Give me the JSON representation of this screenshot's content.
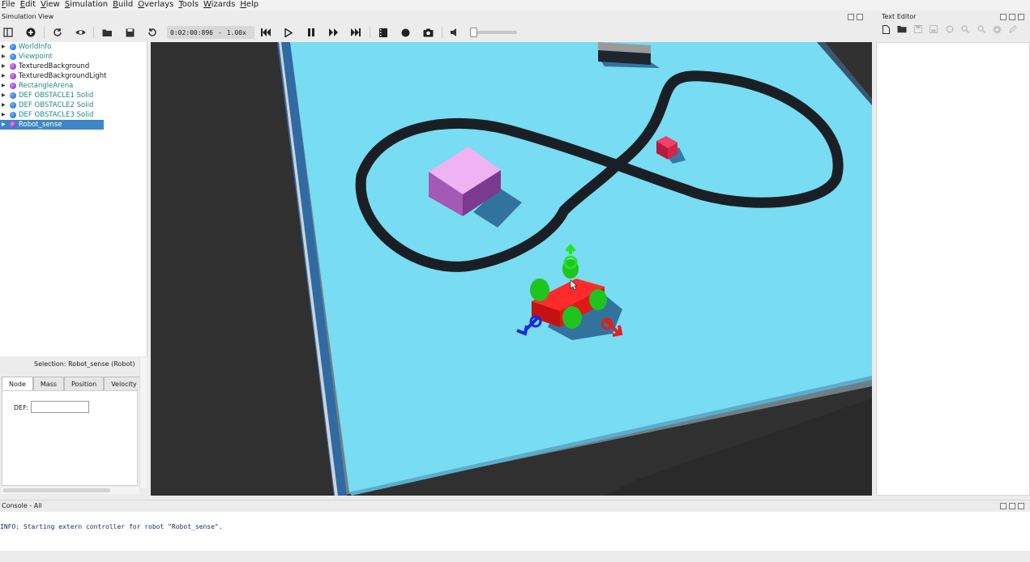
{
  "menu": [
    "File",
    "Edit",
    "View",
    "Simulation",
    "Build",
    "Overlays",
    "Tools",
    "Wizards",
    "Help"
  ],
  "simulation_view": {
    "title": "Simulation View"
  },
  "toolbar": {
    "icons": [
      "toggle-scene-tree-icon",
      "add-node-icon",
      "reload-icon",
      "eye-icon",
      "open-world-icon",
      "save-world-icon",
      "revert-icon",
      "step-back-icon",
      "play-icon",
      "pause-icon",
      "fast-forward-icon",
      "fastest-icon",
      "record-movie-icon",
      "record-icon",
      "screenshot-icon",
      "mute-icon"
    ],
    "time": "0:02:00:896",
    "time_separator": "-",
    "speed": "1.00x"
  },
  "scene_tree": {
    "items": [
      {
        "label": "WorldInfo",
        "icon": "blue",
        "teal": true
      },
      {
        "label": "Viewpoint",
        "icon": "blue",
        "teal": true
      },
      {
        "label": "TexturedBackground",
        "icon": "purple",
        "teal": false
      },
      {
        "label": "TexturedBackgroundLight",
        "icon": "purple",
        "teal": false
      },
      {
        "label": "RectangleArena",
        "icon": "purple",
        "teal": true
      },
      {
        "label": "DEF OBSTACLE1 Solid",
        "icon": "blue",
        "teal": true
      },
      {
        "label": "DEF OBSTACLE2 Solid",
        "icon": "blue",
        "teal": true
      },
      {
        "label": "DEF OBSTACLE3 Solid",
        "icon": "blue",
        "teal": true
      },
      {
        "label": "Robot_sense",
        "icon": "purple",
        "teal": false,
        "selected": true
      }
    ]
  },
  "field_editor": {
    "selection": "Selection: Robot_sense (Robot)",
    "tabs": [
      "Node",
      "Mass",
      "Position",
      "Velocity"
    ],
    "active_tab": "Node",
    "def_label": "DEF:",
    "def_value": ""
  },
  "text_editor": {
    "title": "Text Editor",
    "icons": [
      "new-file-icon",
      "open-file-icon",
      "save-file-icon",
      "save-all-icon",
      "revert-file-icon",
      "find-icon",
      "replace-icon",
      "gear-icon",
      "edit-icon"
    ]
  },
  "console": {
    "title": "Console - All",
    "lines": [
      "INFO: Starting extern controller for robot \"Robot_sense\"."
    ]
  },
  "colors": {
    "floor": "#78dcf2",
    "background": "#2e2e2e",
    "track": "#1a1f26",
    "obstacle_pink": "#e9a3ee",
    "obstacle_red": "#e8224c",
    "robot": "#ff1a1a",
    "wheels": "#1fc41f"
  }
}
